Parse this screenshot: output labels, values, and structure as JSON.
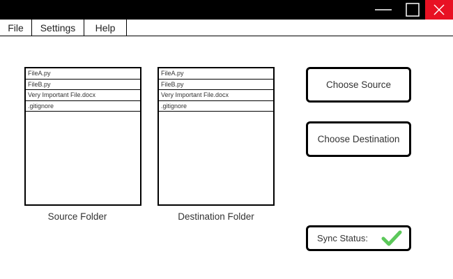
{
  "window": {
    "controls": {
      "minimize_icon": "minimize-icon",
      "maximize_icon": "maximize-icon",
      "close_icon": "close-icon",
      "close_color": "#e81123"
    }
  },
  "menu": {
    "items": [
      {
        "label": "File"
      },
      {
        "label": "Settings"
      },
      {
        "label": "Help"
      }
    ]
  },
  "source": {
    "files": [
      "FileA.py",
      "FileB.py",
      "Very Important File.docx",
      ".gitignore"
    ],
    "caption": "Source Folder"
  },
  "destination": {
    "files": [
      "FileA.py",
      "FileB.py",
      "Very Important File.docx",
      ".gitignore"
    ],
    "caption": "Destination Folder"
  },
  "buttons": {
    "choose_source": "Choose Source",
    "choose_destination": "Choose Destination"
  },
  "sync": {
    "label": "Sync Status:",
    "status_icon": "checkmark-icon",
    "status_color": "#5cc85a"
  }
}
